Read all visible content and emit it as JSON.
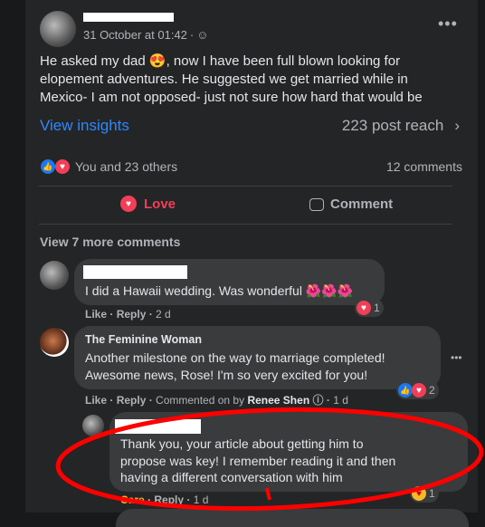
{
  "post": {
    "date": "31 October at 01:42",
    "privacy_icon": "friends-icon",
    "text_lines": [
      "He asked my dad 😍, now I have been full blown looking for",
      "elopement adventures.  He suggested we get married while in",
      "Mexico- I am not opposed- just not sure how hard that would be"
    ],
    "view_insights": "View insights",
    "reach": "223 post reach",
    "reactions_text": "You and 23 others",
    "comments_count": "12 comments",
    "love_label": "Love",
    "comment_label": "Comment",
    "view_more": "View 7 more comments"
  },
  "colors": {
    "accent": "#2d88ff",
    "love": "#f33e58",
    "care": "#f7b928",
    "annotation": "#ff0000"
  },
  "comments": [
    {
      "text": "I did a Hawaii wedding. Was wonderful 🌺🌺🌺",
      "reaction_count": "1",
      "like": "Like",
      "reply": "Reply",
      "time": "2 d"
    },
    {
      "author": "The Feminine Woman",
      "lines": [
        "Another milestone on the way to marriage completed!",
        "Awesome news, Rose! I'm so very excited for you!"
      ],
      "reaction_count": "2",
      "like": "Like",
      "reply": "Reply",
      "commented_on_by": "Commented on by",
      "commenter": "Renee Shen",
      "time": "1 d"
    },
    {
      "lines": [
        "Thank you, your article about getting him to",
        "propose was key! I remember reading it and then",
        "having a different conversation with him"
      ],
      "reaction_count": "1",
      "reaction": "Care",
      "reply": "Reply",
      "time": "1 d"
    }
  ]
}
